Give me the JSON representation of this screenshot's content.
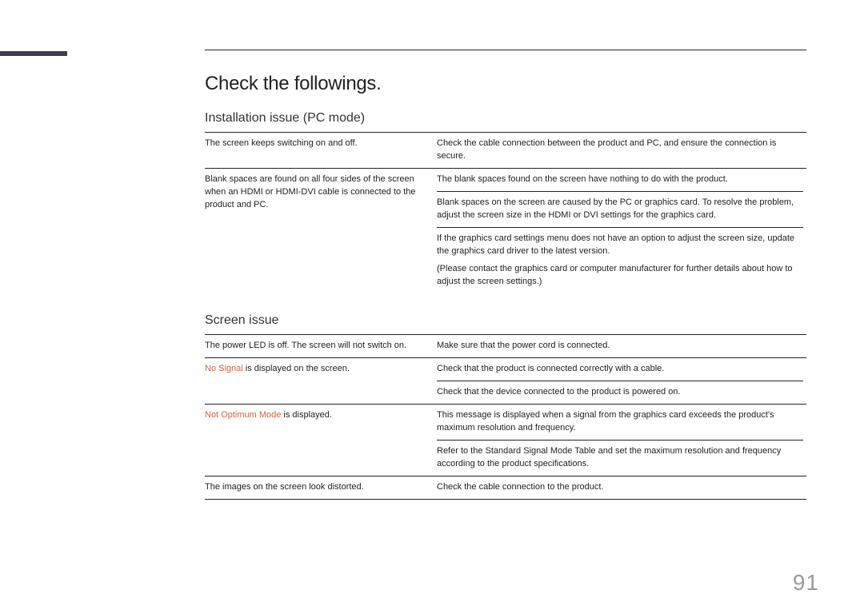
{
  "title": "Check the followings.",
  "page_number": "91",
  "section1": {
    "heading": "Installation issue (PC mode)",
    "rows": [
      {
        "problem": {
          "parts": [
            {
              "text": "The screen keeps switching on and off."
            }
          ]
        },
        "solution": {
          "parts": [
            {
              "text": "Check the cable connection between the product and PC, and ensure the connection is secure."
            }
          ]
        }
      },
      {
        "problem": {
          "parts": [
            {
              "text": "Blank spaces are found on all four sides of the screen when an HDMI or HDMI-DVI cable is connected to the product and PC."
            }
          ]
        },
        "solution": {
          "parts": [
            {
              "text": "The blank spaces found on the screen have nothing to do with the product."
            },
            {
              "sep": true,
              "text": "Blank spaces on the screen are caused by the PC or graphics card. To resolve the problem, adjust the screen size in the HDMI or DVI settings for the graphics card."
            },
            {
              "sep": true,
              "text": "If the graphics card settings menu does not have an option to adjust the screen size, update the graphics card driver to the latest version."
            },
            {
              "text": "(Please contact the graphics card or computer manufacturer for further details about how to adjust the screen settings.)"
            }
          ]
        }
      }
    ]
  },
  "section2": {
    "heading": "Screen issue",
    "rows": [
      {
        "problem": {
          "parts": [
            {
              "text": "The power LED is off. The screen will not switch on."
            }
          ]
        },
        "solution": {
          "parts": [
            {
              "text": "Make sure that the power cord is connected."
            }
          ]
        }
      },
      {
        "problem": {
          "parts": [
            {
              "highlight": true,
              "text": "No Signal"
            },
            {
              "inline": true,
              "text": " is displayed on the screen."
            }
          ]
        },
        "solution": {
          "parts": [
            {
              "text": "Check that the product is connected correctly with a cable."
            },
            {
              "sep": true,
              "text": "Check that the device connected to the product is powered on."
            }
          ]
        }
      },
      {
        "problem": {
          "parts": [
            {
              "highlight": true,
              "text": "Not Optimum Mode"
            },
            {
              "inline": true,
              "text": " is displayed."
            }
          ]
        },
        "solution": {
          "parts": [
            {
              "text": "This message is displayed when a signal from the graphics card exceeds the product's maximum resolution and frequency."
            },
            {
              "sep": true,
              "text": "Refer to the Standard Signal Mode Table and set the maximum resolution and frequency according to the product specifications."
            }
          ]
        }
      },
      {
        "problem": {
          "parts": [
            {
              "text": "The images on the screen look distorted."
            }
          ]
        },
        "solution": {
          "parts": [
            {
              "text": "Check the cable connection to the product."
            }
          ]
        }
      }
    ]
  }
}
